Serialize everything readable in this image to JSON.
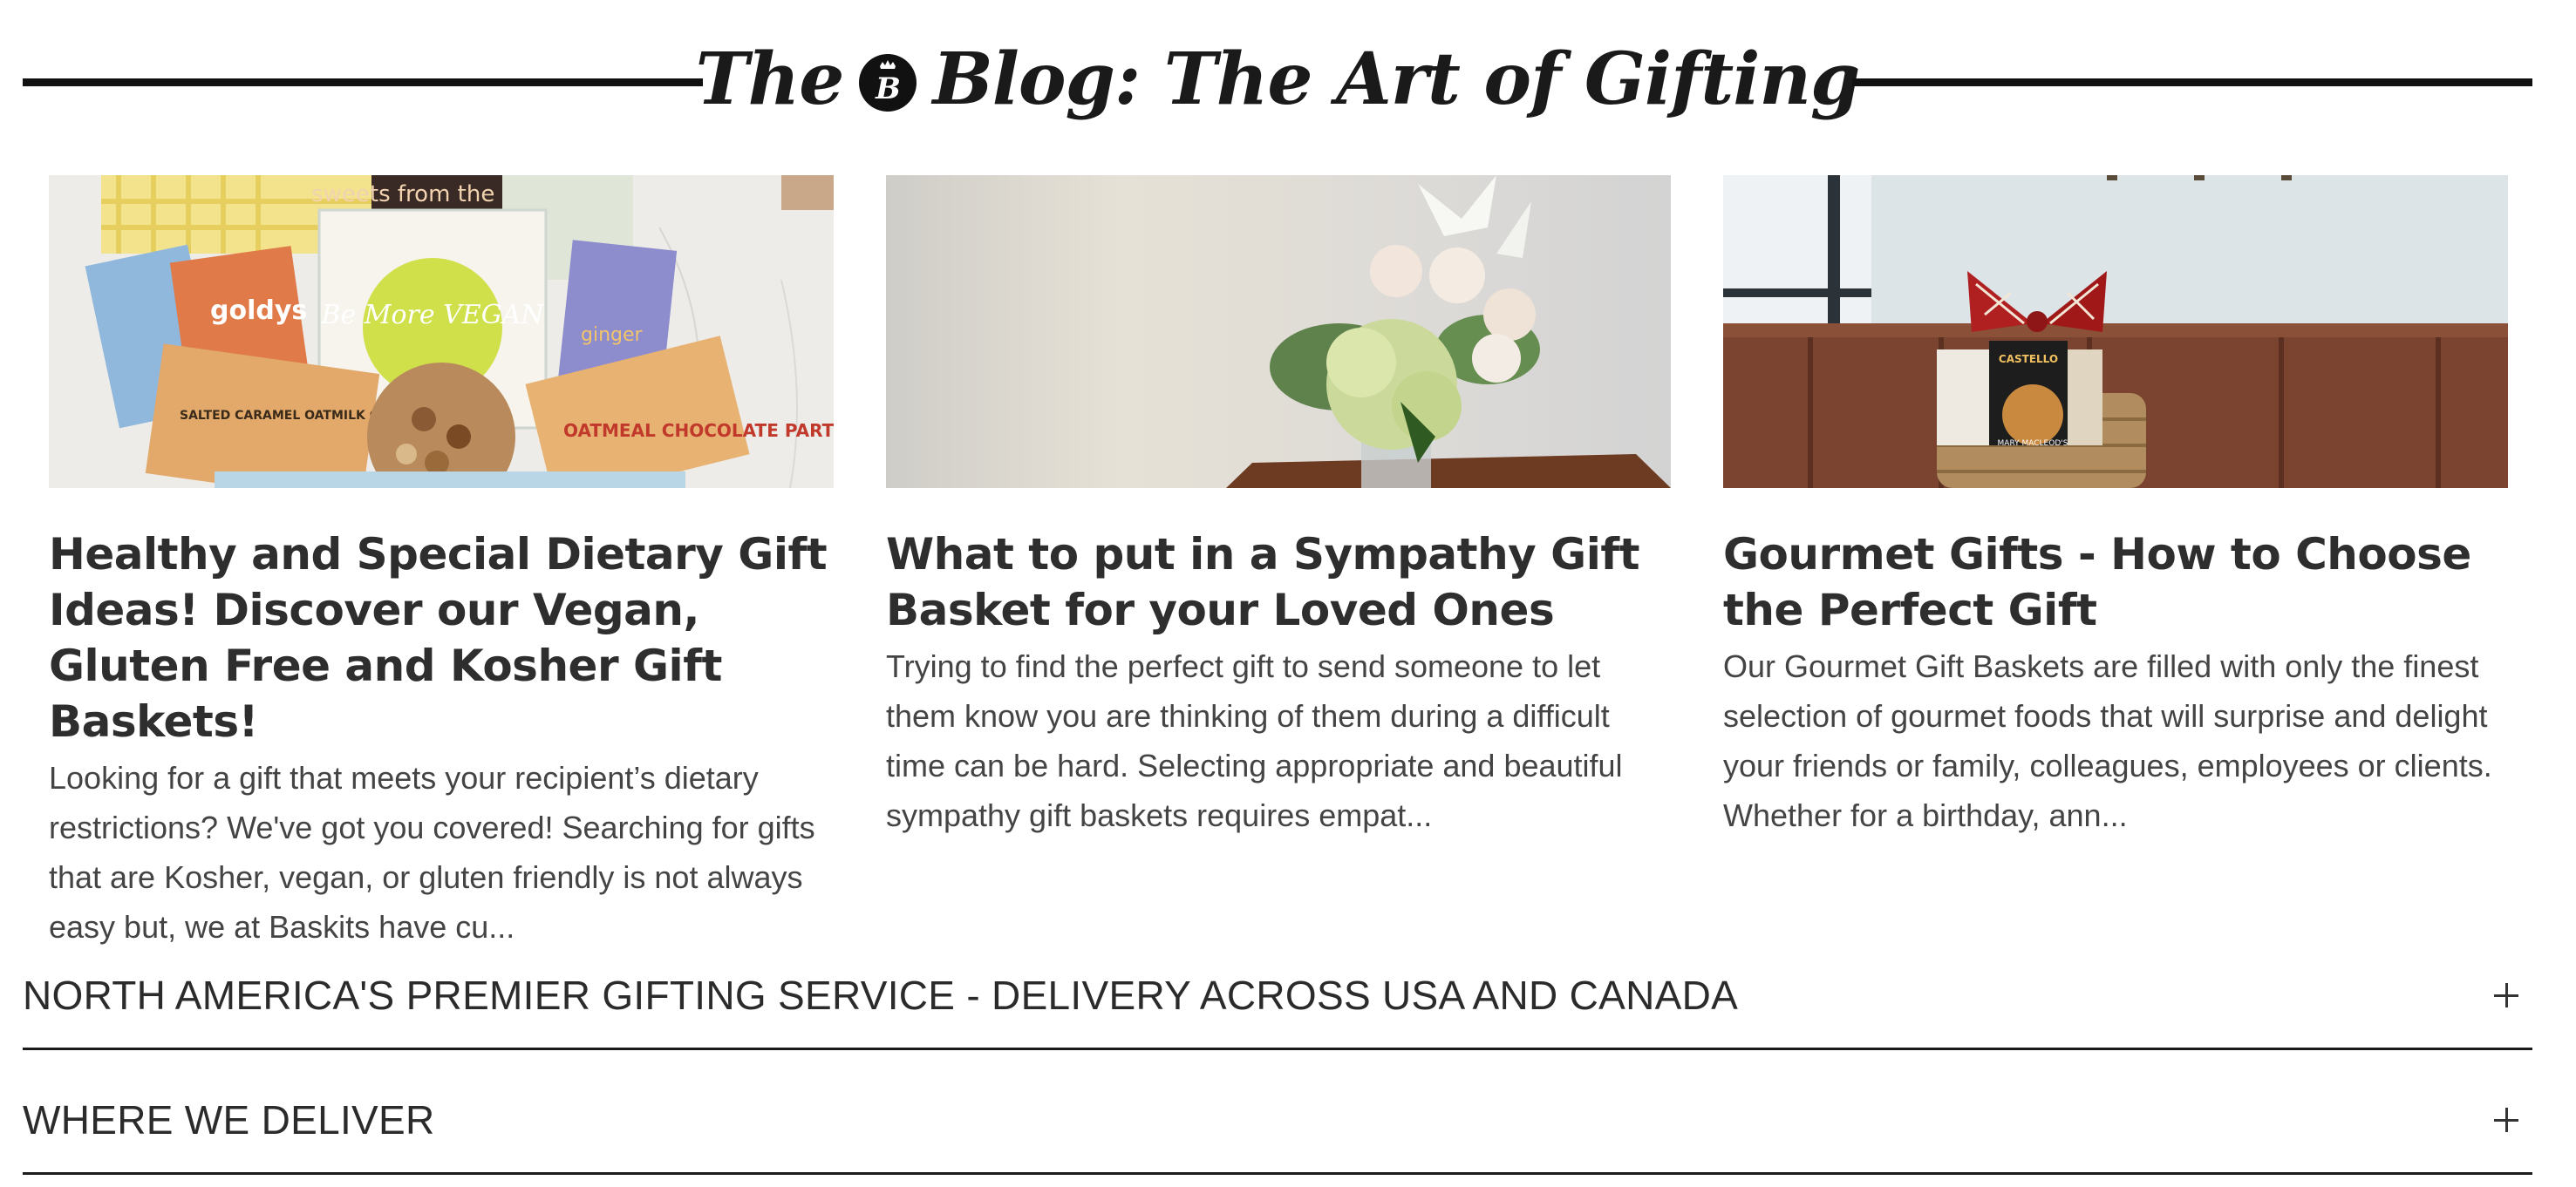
{
  "blog": {
    "title_before_logo": "The",
    "title_after_logo": "Blog: The Art of Gifting",
    "logo_letter": "B",
    "logo_name": "baskits-crown-b-logo"
  },
  "posts": [
    {
      "title": "Healthy and Special Dietary Gift Ideas! Discover our Vegan, Gluten Free and Kosher Gift Baskets!",
      "excerpt": "Looking for a gift that meets your recipient’s dietary restrictions? We've got you covered! Searching for gifts that are Kosher, vegan, or gluten friendly is not always easy but, we at Baskits have cu...",
      "image": {
        "subject": "vegan-gift-basket-photo",
        "texts": [
          "sweets from the earth",
          "goldys",
          "Be More VEGAN",
          "OATMEAL CHOCOLATE PARTY!",
          "SALTED CARAMEL OATMILK CHOCOLATE",
          "ginger"
        ]
      }
    },
    {
      "title": "What to put in a Sympathy Gift Basket for your Loved Ones",
      "excerpt": "Trying to find the perfect gift to send someone to let them know you are thinking of them during a difficult time can be hard. Selecting appropriate and beautiful sympathy gift baskets requires empat...",
      "image": {
        "subject": "sympathy-flower-arrangement-photo",
        "texts": []
      }
    },
    {
      "title": "Gourmet Gifts - How to Choose the Perfect Gift",
      "excerpt": "Our Gourmet Gift Baskets are filled with only the finest selection of gourmet foods that will surprise and delight your friends or family, colleagues, employees or clients. Whether for a birthday, ann...",
      "image": {
        "subject": "gourmet-gift-basket-photo",
        "texts": [
          "CASTELLO",
          "MARY MACLEOD'S"
        ]
      }
    }
  ],
  "accordions": [
    {
      "label": "NORTH AMERICA'S PREMIER GIFTING SERVICE - DELIVERY ACROSS USA AND CANADA",
      "icon": "plus-icon"
    },
    {
      "label": "WHERE WE DELIVER",
      "icon": "plus-icon"
    }
  ],
  "colors": {
    "text": "#333333",
    "rule": "#111111",
    "background": "#ffffff"
  }
}
